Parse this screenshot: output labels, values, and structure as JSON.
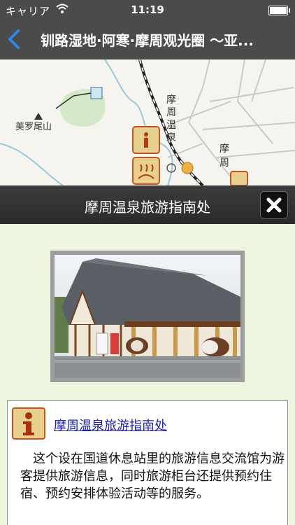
{
  "status_bar": {
    "carrier": "キャリア",
    "time": "11:19",
    "wifi_icon": "wifi-icon",
    "battery_icon": "battery-icon"
  },
  "nav": {
    "title": "钏路湿地·阿寒·摩周观光圈 ～亚...",
    "back_icon": "chevron-left-icon"
  },
  "map": {
    "labels": {
      "mountain": "美罗尾山",
      "onsen": "摩周温泉",
      "mashu": "摩周"
    }
  },
  "popup": {
    "header_title": "摩周温泉旅游指南处",
    "close_icon": "close-icon"
  },
  "info": {
    "icon": "info-icon",
    "link_text": "摩周温泉旅游指南处",
    "description": "这个设在国道休息站里的旅游信息交流馆为游客提供旅游信息，同时旅游柜台还提供预约住宿、预约安排体验活动等的服务。"
  },
  "colors": {
    "nav_bg": "#4b4b4b",
    "back_accent": "#2f86e8",
    "page_bg": "#eef6df",
    "link": "#1a1fbf",
    "icon_border": "#c55520"
  }
}
